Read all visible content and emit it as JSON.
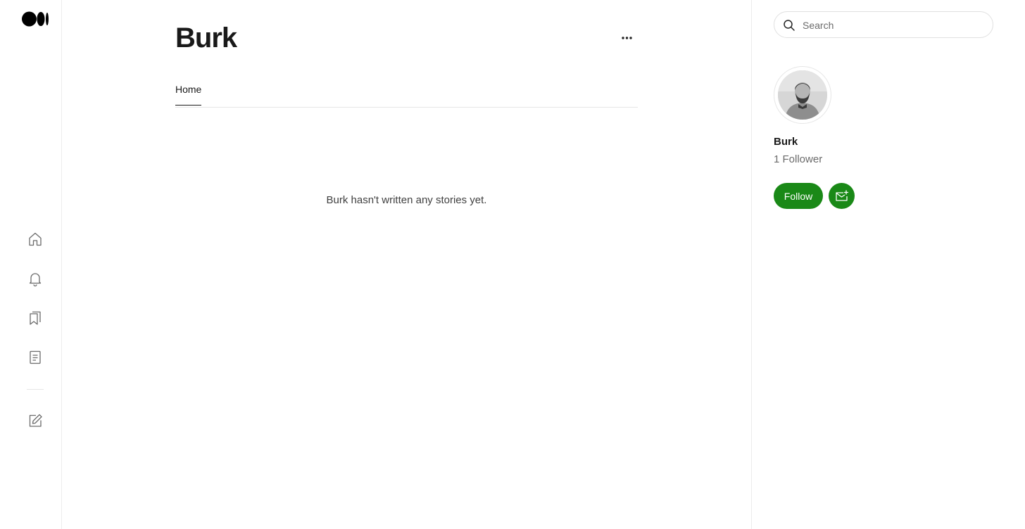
{
  "sidebar": {
    "logo": "medium-logo-icon",
    "items": [
      {
        "icon": "home-icon"
      },
      {
        "icon": "bell-icon"
      },
      {
        "icon": "bookmarks-icon"
      },
      {
        "icon": "stories-icon"
      },
      {
        "icon": "write-icon"
      }
    ]
  },
  "main": {
    "title": "Burk",
    "tabs": [
      {
        "label": "Home"
      }
    ],
    "empty_message": "Burk hasn't written any stories yet."
  },
  "right": {
    "search": {
      "placeholder": "Search",
      "value": ""
    },
    "author": {
      "name": "Burk",
      "followers": "1 Follower"
    },
    "follow_label": "Follow"
  },
  "colors": {
    "accent": "#1a8917",
    "text": "#191919",
    "muted": "#6b6b6b",
    "border": "#e6e6e6"
  }
}
